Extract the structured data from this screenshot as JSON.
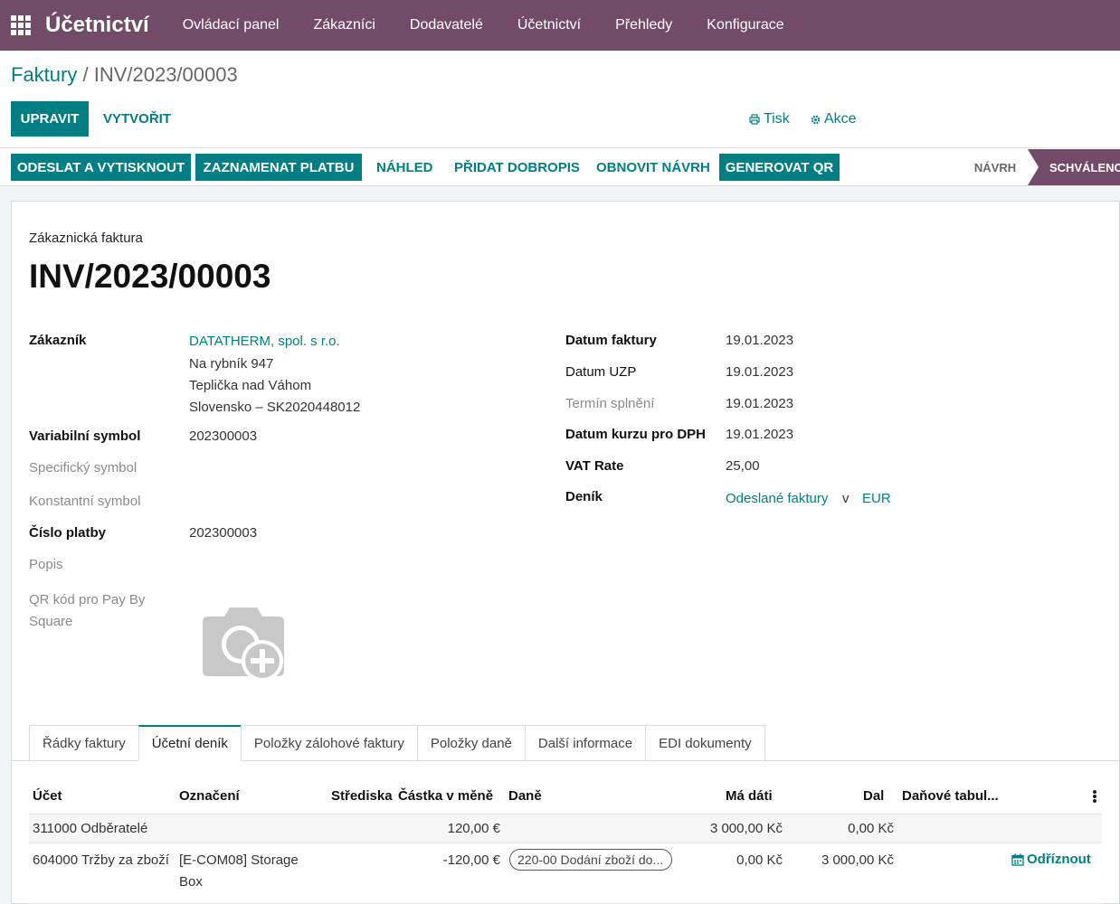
{
  "topbar": {
    "brand": "Účetnictví",
    "menu": [
      "Ovládací panel",
      "Zákazníci",
      "Dodavatelé",
      "Účetnictví",
      "Přehledy",
      "Konfigurace"
    ]
  },
  "breadcrumb": {
    "parent": "Faktury",
    "separator": " / ",
    "current": "INV/2023/00003"
  },
  "control": {
    "edit": "UPRAVIT",
    "create": "VYTVOŘIT",
    "print": "Tisk",
    "action": "Akce"
  },
  "statusbar_buttons": {
    "send_print": "ODESLAT A VYTISKNOUT",
    "register_payment": "ZAZNAMENAT PLATBU",
    "preview": "NÁHLED",
    "add_credit": "PŘIDAT DOBROPIS",
    "reset_draft": "OBNOVIT NÁVRH",
    "generate_qr": "GENEROVAT QR"
  },
  "status": {
    "draft": "NÁVRH",
    "posted": "SCHVÁLENO"
  },
  "doc": {
    "type": "Zákaznická faktura",
    "number": "INV/2023/00003"
  },
  "left_fields": {
    "customer_label": "Zákazník",
    "customer_name": "DATATHERM, spol. s r.o.",
    "customer_addr1": "Na rybník 947",
    "customer_addr2": "Teplička nad Váhom",
    "customer_addr3": "Slovensko – SK2020448012",
    "vs_label": "Variabilní symbol",
    "vs_value": "202300003",
    "ss_label": "Specifický symbol",
    "ks_label": "Konstantní symbol",
    "payref_label": "Číslo platby",
    "payref_value": "202300003",
    "desc_label": "Popis",
    "qr_label": "QR kód pro Pay By Square"
  },
  "right_fields": {
    "invoice_date_label": "Datum faktury",
    "invoice_date": "19.01.2023",
    "uzp_label": "Datum UZP",
    "uzp_date": "19.01.2023",
    "due_label": "Termín splnění",
    "due_date": "19.01.2023",
    "rate_date_label": "Datum kurzu pro DPH",
    "rate_date": "19.01.2023",
    "vat_rate_label": "VAT Rate",
    "vat_rate": "25,00",
    "journal_label": "Deník",
    "journal": "Odeslané faktury",
    "journal_in": "v",
    "currency": "EUR"
  },
  "tabs": [
    "Řádky faktury",
    "Účetní deník",
    "Položky zálohové faktury",
    "Položky daně",
    "Další informace",
    "EDI dokumenty"
  ],
  "table": {
    "headers": {
      "account": "Účet",
      "label": "Označení",
      "analytic": "Střediska",
      "amount_currency": "Částka v měně",
      "taxes": "Daně",
      "debit": "Má dáti",
      "credit": "Dal",
      "tax_grid": "Daňové tabul..."
    },
    "rows": [
      {
        "account": "311000 Odběratelé",
        "label": "",
        "amount_currency": "120,00 €",
        "tax": "",
        "debit": "3 000,00 Kč",
        "credit": "0,00 Kč"
      },
      {
        "account": "604000 Tržby za zboží",
        "label1": "[E-COM08] Storage",
        "label2": "Box",
        "amount_currency": "-120,00 €",
        "tax": "220-00 Dodání zboží do...",
        "debit": "0,00 Kč",
        "credit": "3 000,00 Kč",
        "action": "Odříznout"
      }
    ]
  },
  "colors": {
    "brand": "#714b67",
    "accent": "#017e84"
  }
}
